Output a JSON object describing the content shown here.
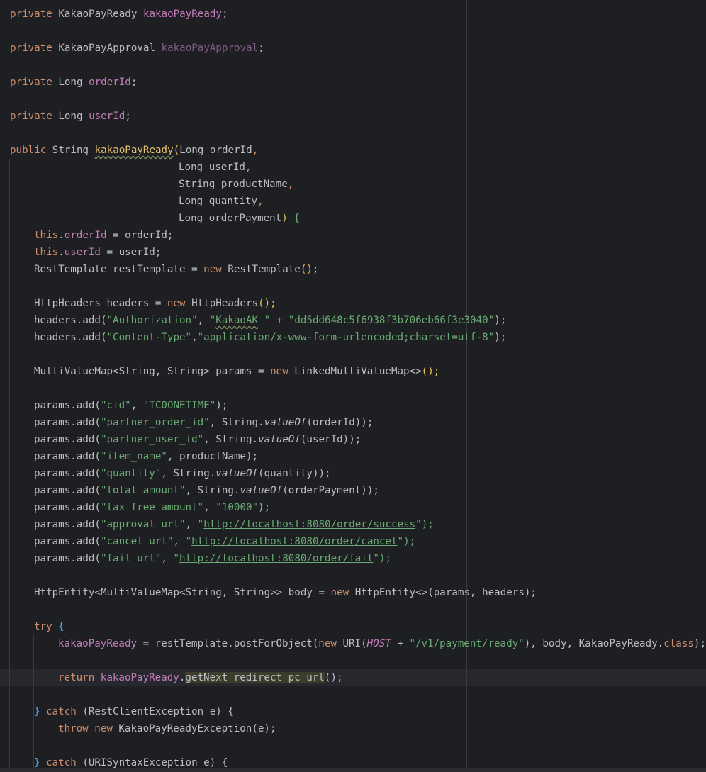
{
  "code_lines": {
    "l01": {
      "kw": "private",
      "type": "KakaoPayReady",
      "name": "kakaoPayReady",
      "end": ";"
    },
    "l02": {
      "kw": "private",
      "type": "KakaoPayApproval",
      "name": "kakaoPayApproval",
      "end": ";"
    },
    "l03": {
      "kw": "private",
      "type": "Long",
      "name": "orderId",
      "end": ";"
    },
    "l04": {
      "kw": "private",
      "type": "Long",
      "name": "userId",
      "end": ";"
    },
    "l05": {
      "kw": "public",
      "type": "String",
      "name": "kakaoPayReady",
      "open": "(",
      "param_type": "Long",
      "param_name": "orderId",
      "end": ","
    },
    "l06": {
      "param_type": "Long",
      "param_name": "userId",
      "end": ","
    },
    "l07": {
      "param_type": "String",
      "param_name": "productName",
      "end": ","
    },
    "l08": {
      "param_type": "Long",
      "param_name": "quantity",
      "end": ","
    },
    "l09": {
      "param_type": "Long",
      "param_name": "orderPayment",
      "close": ")",
      "brace": "{"
    },
    "l10": {
      "this": "this",
      "field": "orderId",
      "rest": " = orderId;"
    },
    "l11": {
      "this": "this",
      "field": "userId",
      "rest": " = userId;"
    },
    "l12": {
      "decl": "RestTemplate restTemplate = ",
      "new": "new",
      "ctor": "RestTemplate",
      "end": "();"
    },
    "l13": {
      "decl": "HttpHeaders headers = ",
      "new": "new",
      "ctor": "HttpHeaders",
      "end": "();"
    },
    "l14": {
      "call": "headers.add(",
      "s1": "\"Authorization\"",
      "sep": ", ",
      "s2a": "\"",
      "s2b": "KakaoAK",
      "s2c": " \"",
      "plus": " + ",
      "s3": "\"dd5dd648c5f6938f3b706eb66f3e3040\"",
      "end": ");"
    },
    "l15": {
      "call": "headers.add(",
      "s1": "\"Content-Type\"",
      "sep": ",",
      "s2": "\"application/x-www-form-urlencoded;charset=utf-8\"",
      "end": ");"
    },
    "l16": {
      "decl": "MultiValueMap<String, String> params = ",
      "new": "new",
      "ctor": "LinkedMultiValueMap<>",
      "end": "();"
    },
    "l17": {
      "call": "params.add(",
      "key": "\"cid\"",
      "sep": ", ",
      "val": "\"TC0ONETIME\"",
      "end": ");"
    },
    "l18": {
      "call": "params.add(",
      "key": "\"partner_order_id\"",
      "sep": ", ",
      "cls": "String.",
      "fn": "valueOf",
      "arg": "(orderId)",
      "end": ");"
    },
    "l19": {
      "call": "params.add(",
      "key": "\"partner_user_id\"",
      "sep": ", ",
      "cls": "String.",
      "fn": "valueOf",
      "arg": "(userId)",
      "end": ");"
    },
    "l20": {
      "call": "params.add(",
      "key": "\"item_name\"",
      "sep": ", ",
      "val_plain": "productName",
      "end": ");"
    },
    "l21": {
      "call": "params.add(",
      "key": "\"quantity\"",
      "sep": ", ",
      "cls": "String.",
      "fn": "valueOf",
      "arg": "(quantity)",
      "end": ");"
    },
    "l22": {
      "call": "params.add(",
      "key": "\"total_amount\"",
      "sep": ", ",
      "cls": "String.",
      "fn": "valueOf",
      "arg": "(orderPayment)",
      "end": ");"
    },
    "l23": {
      "call": "params.add(",
      "key": "\"tax_free_amount\"",
      "sep": ", ",
      "val": "\"10000\"",
      "end": ");"
    },
    "l24": {
      "call": "params.add(",
      "key": "\"approval_url\"",
      "sep": ", ",
      "q": "\"",
      "url": "http://localhost:8080/order/success",
      "end": "\");"
    },
    "l25": {
      "call": "params.add(",
      "key": "\"cancel_url\"",
      "sep": ", ",
      "q": "\"",
      "url": "http://localhost:8080/order/cancel",
      "end": "\");"
    },
    "l26": {
      "call": "params.add(",
      "key": "\"fail_url\"",
      "sep": ", ",
      "q": "\"",
      "url": "http://localhost:8080/order/fail",
      "end": "\");"
    },
    "l27": {
      "decl": "HttpEntity<MultiValueMap<String, String>> body = ",
      "new": "new",
      "ctor": "HttpEntity<>",
      "end": "(params, headers);"
    },
    "l28": {
      "kw": "try",
      "brace": " {"
    },
    "l29": {
      "field": "kakaoPayReady",
      "mid": " = restTemplate.postForObject(",
      "new": "new",
      "uri": " URI(",
      "const": "HOST",
      "plus": " + ",
      "str": "\"/v1/payment/ready\"",
      "tail": "), body, KakaoPayReady.",
      "cls_kw": "class",
      "end": ");"
    },
    "l30": {
      "kw": "return",
      "sp": " ",
      "field": "kakaoPayReady",
      "dot": ".",
      "method": "getNext_redirect_pc_url",
      "end": "();"
    },
    "l31": {
      "brace": "} ",
      "kw": "catch",
      "rest": " (RestClientException e) {"
    },
    "l32": {
      "kw1": "throw",
      "sp": " ",
      "kw2": "new",
      "rest": " KakaoPayReadyException(e);"
    },
    "l33": {
      "brace": "} ",
      "kw": "catch",
      "rest": " (URISyntaxException e) {"
    }
  }
}
